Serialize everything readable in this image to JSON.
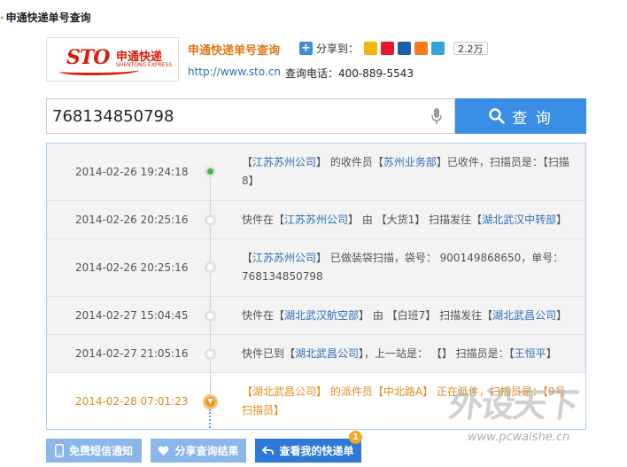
{
  "page_title": "申通快递单号查询",
  "header": {
    "logo_text": "STO",
    "logo_cn": "申通快递",
    "logo_en": "SHENTONG EXPRESS",
    "app_title": "申通快递单号查询",
    "share_label": "分享到：",
    "share_icons": [
      "qzone-icon",
      "weibo-icon",
      "renren-icon",
      "douban-icon",
      "tencent-weibo-icon"
    ],
    "share_count": "2.2万",
    "site_url": "http://www.sto.cn",
    "phone": "查询电话：400-889-5543"
  },
  "search": {
    "value": "768134850798",
    "button_label": "查 询"
  },
  "tracking": [
    {
      "time": "2014-02-26 19:24:18",
      "parts": [
        {
          "t": "【",
          "p": false
        },
        {
          "t": "江苏苏州公司",
          "p": true
        },
        {
          "t": "】 的收件员【",
          "p": false
        },
        {
          "t": "苏州业务部",
          "p": true
        },
        {
          "t": "】已收件，扫描员是：【扫描8】",
          "p": false
        }
      ]
    },
    {
      "time": "2014-02-26 20:25:16",
      "parts": [
        {
          "t": "快件在【",
          "p": false
        },
        {
          "t": "江苏苏州公司",
          "p": true
        },
        {
          "t": "】 由 【大货1】 扫描发往【",
          "p": false
        },
        {
          "t": "湖北武汉中转部",
          "p": true
        },
        {
          "t": "】",
          "p": false
        }
      ]
    },
    {
      "time": "2014-02-26 20:25:16",
      "parts": [
        {
          "t": "【",
          "p": false
        },
        {
          "t": "江苏苏州公司",
          "p": true
        },
        {
          "t": "】 已做装袋扫描，袋号： 900149868650，单号：768134850798",
          "p": false
        }
      ]
    },
    {
      "time": "2014-02-27 15:04:45",
      "parts": [
        {
          "t": "快件在【",
          "p": false
        },
        {
          "t": "湖北武汉航空部",
          "p": true
        },
        {
          "t": "】 由 【白班7】 扫描发往【",
          "p": false
        },
        {
          "t": "湖北武昌公司",
          "p": true
        },
        {
          "t": "】",
          "p": false
        }
      ]
    },
    {
      "time": "2014-02-27 21:05:16",
      "parts": [
        {
          "t": "快件已到【",
          "p": false
        },
        {
          "t": "湖北武昌公司",
          "p": true
        },
        {
          "t": "】，上一站是： 【】 扫描员是：【",
          "p": false
        },
        {
          "t": "王恒平",
          "p": true
        },
        {
          "t": "】",
          "p": false
        }
      ]
    },
    {
      "time": "2014-02-28 07:01:23",
      "parts": [
        {
          "t": "【",
          "p": false
        },
        {
          "t": "湖北武昌公司",
          "p": true
        },
        {
          "t": "】 的派件员【",
          "p": false
        },
        {
          "t": "中北路A",
          "p": true
        },
        {
          "t": "】 正在派件，扫描员是：【9号扫描员】",
          "p": false
        }
      ]
    }
  ],
  "buttons": {
    "sms": "免费短信通知",
    "share_result": "分享查询结果",
    "my_express": "查看我的快递单",
    "badge": "1"
  },
  "watermark": {
    "big": "外设天下",
    "url": "www.pcwaishe.cn"
  },
  "colors": {
    "accent_orange": "#e07a1c",
    "link_blue": "#2b6fba",
    "search_button": "#3a8ee6",
    "current_step": "#e08b1a"
  }
}
